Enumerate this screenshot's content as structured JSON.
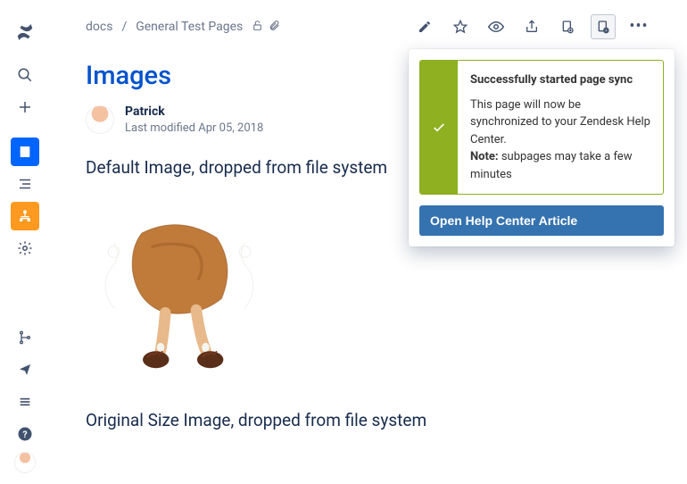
{
  "breadcrumb": {
    "root": "docs",
    "sep": "/",
    "current": "General Test Pages"
  },
  "page": {
    "title": "Images",
    "author": "Patrick",
    "modified_prefix": "Last modified ",
    "modified_date": "Apr 05, 2018",
    "section1": "Default Image, dropped from file system",
    "section2": "Original Size Image, dropped from file system"
  },
  "popover": {
    "alert_title": "Successfully started page sync",
    "alert_line1": "This page will now be synchronized to your Zendesk Help Center.",
    "alert_note_label": "Note:",
    "alert_note_rest": " subpages may take a few minutes",
    "button": "Open Help Center Article"
  },
  "icons": {
    "logo": "confluence-logo",
    "search": "search-icon",
    "add": "plus-icon",
    "pages": "page-icon",
    "tree": "tree-icon",
    "hierarchy": "hierarchy-icon",
    "gear": "gear-icon",
    "branch": "branch-icon",
    "announce": "announce-icon",
    "list": "list-icon",
    "help": "help-icon",
    "unlock": "unlock-icon",
    "attach": "attachment-icon",
    "edit": "pencil-icon",
    "star": "star-icon",
    "watch": "eye-icon",
    "share": "share-icon",
    "doc1": "doc-action-icon",
    "doc2": "doc-sync-icon",
    "more": "more-icon"
  }
}
